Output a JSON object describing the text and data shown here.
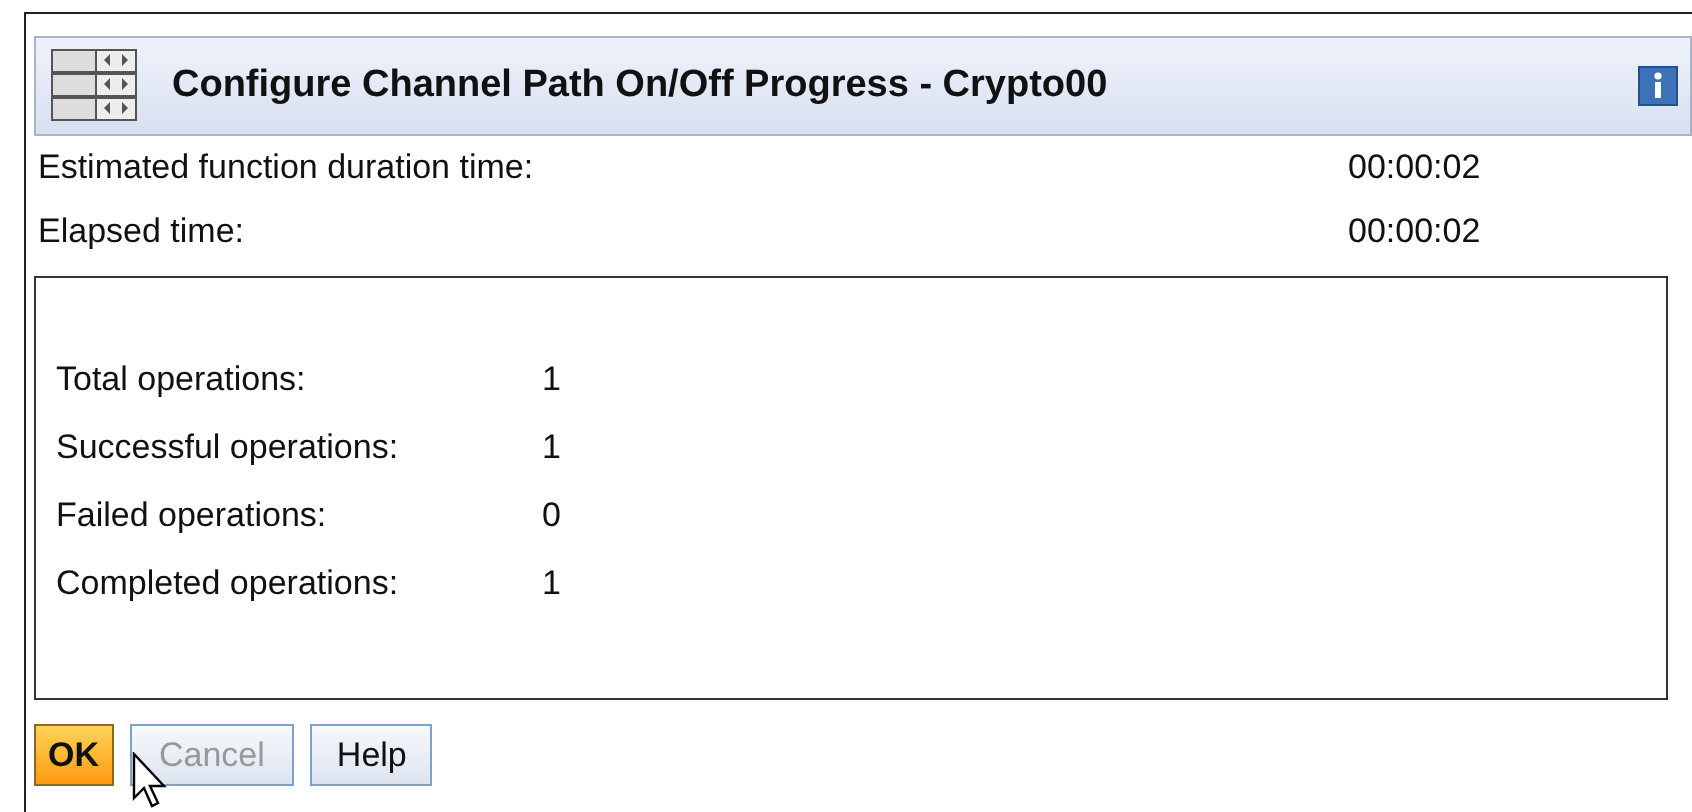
{
  "window": {
    "title": "Configure Channel Path On/Off Progress - Crypto00"
  },
  "info": [
    {
      "label": "Estimated function duration time:",
      "value": "00:00:02"
    },
    {
      "label": "Elapsed time:",
      "value": "00:00:02"
    }
  ],
  "results": [
    {
      "label": "Total operations:",
      "value": "1"
    },
    {
      "label": "Successful operations:",
      "value": "1"
    },
    {
      "label": "Failed operations:",
      "value": "0"
    },
    {
      "label": "Completed operations:",
      "value": "1"
    }
  ],
  "buttons": [
    {
      "label": "OK",
      "primary": true,
      "disabled": false
    },
    {
      "label": "Cancel",
      "primary": false,
      "disabled": true
    },
    {
      "label": "Help",
      "primary": false,
      "disabled": false
    }
  ]
}
